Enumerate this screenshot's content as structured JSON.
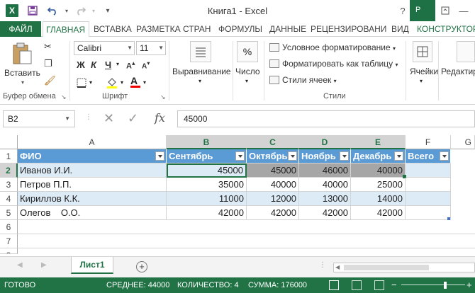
{
  "window": {
    "title": "Книга1 - Excel",
    "contextual_tab_title": "Р",
    "help": "?"
  },
  "tabs": [
    "ФАЙЛ",
    "ГЛАВНАЯ",
    "ВСТАВКА",
    "РАЗМЕТКА СТРАН",
    "ФОРМУЛЫ",
    "ДАННЫЕ",
    "РЕЦЕНЗИРОВАНИ",
    "ВИД",
    "КОНСТРУКТОР"
  ],
  "ribbon": {
    "paste_label": "Вставить",
    "clipboard_group": "Буфер обмена",
    "font_name": "Calibri",
    "font_size": "11",
    "bold": "Ж",
    "italic": "К",
    "underline": "Ч",
    "font_group": "Шрифт",
    "alignment_label": "Выравнивание",
    "number_label": "Число",
    "number_symbol": "%",
    "cond_format": "Условное форматирование",
    "format_table": "Форматировать как таблицу",
    "cell_styles": "Стили ячеек",
    "styles_group": "Стили",
    "cells_label": "Ячейки",
    "editing_label": "Редактир"
  },
  "formula_bar": {
    "name_box": "B2",
    "fx": "fx",
    "value": "45000"
  },
  "grid": {
    "columns": [
      "A",
      "B",
      "C",
      "D",
      "E",
      "F",
      "G"
    ],
    "rows": [
      "1",
      "2",
      "3",
      "4",
      "5",
      "6",
      "7",
      "8"
    ],
    "header": [
      "ФИО",
      "Сентябрь",
      "Октябрь",
      "Ноябрь",
      "Декабрь",
      "Всего"
    ],
    "data": [
      [
        "Иванов И.И.",
        "45000",
        "45000",
        "46000",
        "40000",
        ""
      ],
      [
        "Петров П.П.",
        "35000",
        "40000",
        "40000",
        "25000",
        ""
      ],
      [
        "Кириллов К.К.",
        "11000",
        "12000",
        "13000",
        "14000",
        ""
      ],
      [
        "Олегов    О.О.",
        "42000",
        "42000",
        "42000",
        "42000",
        ""
      ]
    ]
  },
  "sheet": {
    "tab_label": "Лист1",
    "add": "+"
  },
  "status": {
    "ready": "ГОТОВО",
    "average": "СРЕДНЕЕ: 44000",
    "count": "КОЛИЧЕСТВО: 4",
    "sum": "СУММА: 176000"
  }
}
